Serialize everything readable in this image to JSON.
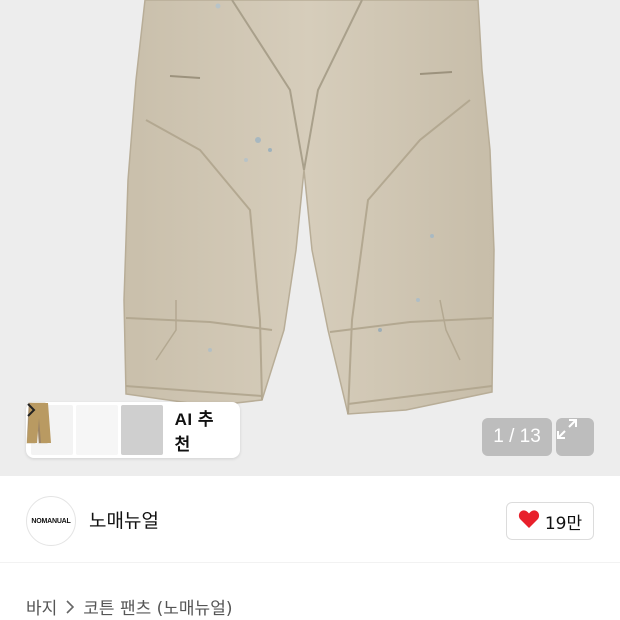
{
  "gallery": {
    "counter": "1 / 13",
    "ai_recommend_label": "AI 추천",
    "thumbnail_colors": [
      "#e6dccb",
      "#9c8466",
      "#b99a62"
    ],
    "pants_color": "#d2c9b6"
  },
  "brand": {
    "logo_text": "NOMANUAL",
    "name": "노매뉴얼",
    "like_count": "19만",
    "heart_color": "#e8202b"
  },
  "breadcrumb": {
    "category": "바지",
    "product": "코튼 팬츠 (노매뉴얼)"
  }
}
